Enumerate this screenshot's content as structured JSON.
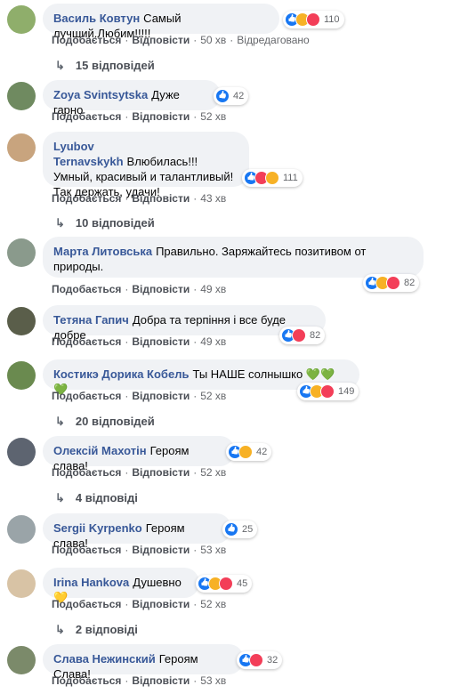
{
  "comments": [
    {
      "author": "Василь Ковтун",
      "text": "Самый лучший.Любим!!!!!",
      "count": "110",
      "like": "Подобається",
      "reply": "Відповісти",
      "time": "50 хв",
      "edited": "Відредаговано",
      "replies": "15 відповідей",
      "avatar_color": "#8fae6b"
    },
    {
      "author": "Zoya Svintsytska",
      "text": "Дуже гарно",
      "count": "42",
      "like": "Подобається",
      "reply": "Відповісти",
      "time": "52 хв",
      "avatar_color": "#6f8a60"
    },
    {
      "author": "Lyubov Ternavskykh",
      "text": "Влюбилась!!! Умный, красивый и талантливый! Так держать, удачи!",
      "count": "111",
      "like": "Подобається",
      "reply": "Відповісти",
      "time": "43 хв",
      "replies": "10 відповідей",
      "avatar_color": "#c8a47e"
    },
    {
      "author": "Марта Литовська",
      "text": "Правильно. Заряжайтесь позитивом от природы.",
      "count": "82",
      "like": "Подобається",
      "reply": "Відповісти",
      "time": "49 хв",
      "avatar_color": "#8a9a8c"
    },
    {
      "author": "Тетяна Гапич",
      "text": "Добра та терпіння і все буде добре",
      "count": "82",
      "like": "Подобається",
      "reply": "Відповісти",
      "time": "49 хв",
      "avatar_color": "#5a5e4a"
    },
    {
      "author": "Костикэ Дорика Кобель",
      "text": "Ты НАШЕ солнышко 💚💚💚",
      "count": "149",
      "like": "Подобається",
      "reply": "Відповісти",
      "time": "52 хв",
      "replies": "20 відповідей",
      "avatar_color": "#6a8a4f"
    },
    {
      "author": "Олексій Махотін",
      "text": "Героям слава!",
      "count": "42",
      "like": "Подобається",
      "reply": "Відповісти",
      "time": "52 хв",
      "replies": "4 відповіді",
      "avatar_color": "#5d6470"
    },
    {
      "author": "Sergii Kyrpenko",
      "text": "Героям слава!",
      "count": "25",
      "like": "Подобається",
      "reply": "Відповісти",
      "time": "53 хв",
      "avatar_color": "#9aa4a8"
    },
    {
      "author": "Irina Hankova",
      "text": "Душевно💛",
      "count": "45",
      "like": "Подобається",
      "reply": "Відповісти",
      "time": "52 хв",
      "replies": "2 відповіді",
      "avatar_color": "#d8c3a5"
    },
    {
      "author": "Слава Нежинский",
      "text": "Героям Слава!",
      "count": "32",
      "like": "Подобається",
      "reply": "Відповісти",
      "time": "53 хв",
      "avatar_color": "#7b8a6a"
    }
  ]
}
